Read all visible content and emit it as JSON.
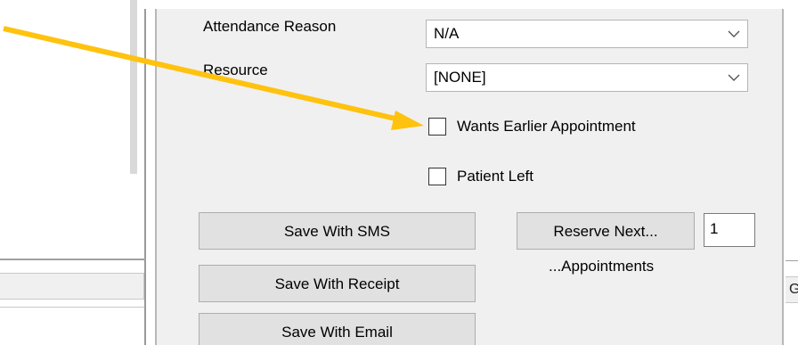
{
  "form": {
    "attendance_reason_label": "Attendance Reason",
    "attendance_reason_value": "N/A",
    "resource_label": "Resource",
    "resource_value": "[NONE]",
    "wants_earlier_label": "Wants Earlier Appointment",
    "wants_earlier_checked": false,
    "patient_left_label": "Patient Left",
    "patient_left_checked": false
  },
  "buttons": {
    "save_sms": "Save With SMS",
    "save_receipt": "Save With Receipt",
    "save_email": "Save With Email",
    "reserve_next": "Reserve Next..."
  },
  "reserve": {
    "count_value": "1",
    "appointments_label": "...Appointments"
  },
  "background": {
    "right_edge_fragment": "G"
  },
  "annotation": {
    "arrow_color": "#FFC20E"
  },
  "icons": {
    "dropdown": "chevron-down-icon"
  }
}
